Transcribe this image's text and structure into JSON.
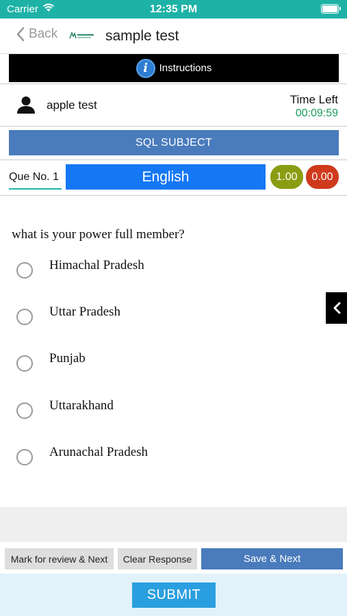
{
  "status_bar": {
    "carrier": "Carrier",
    "time": "12:35 PM"
  },
  "nav": {
    "back_label": "Back",
    "title": "sample test"
  },
  "instructions": {
    "label": "Instructions",
    "icon": "info-icon",
    "icon_glyph": "i"
  },
  "user": {
    "name": "apple test",
    "time_left_label": "Time Left",
    "time_left_value": "00:09:59"
  },
  "subject": {
    "label": "SQL SUBJECT"
  },
  "question_bar": {
    "que_no": "Que No. 1",
    "language": "English",
    "positive_marks": "1.00",
    "negative_marks": "0.00"
  },
  "question": {
    "text": "what is your power full member?",
    "options": [
      "Himachal Pradesh",
      "Uttar Pradesh",
      "Punjab",
      "Uttarakhand",
      "Arunachal Pradesh"
    ]
  },
  "actions": {
    "mark_review": "Mark for review & Next",
    "clear_response": "Clear Response",
    "save_next": "Save & Next",
    "submit": "SUBMIT"
  },
  "colors": {
    "status_bar": "#1eb2a6",
    "subject_bar": "#4a7bbc",
    "language_button": "#1478f5",
    "positive_marks": "#8a9d12",
    "negative_marks": "#cf3a1d",
    "time_left": "#1a9d5a",
    "submit": "#2a9fdf"
  }
}
